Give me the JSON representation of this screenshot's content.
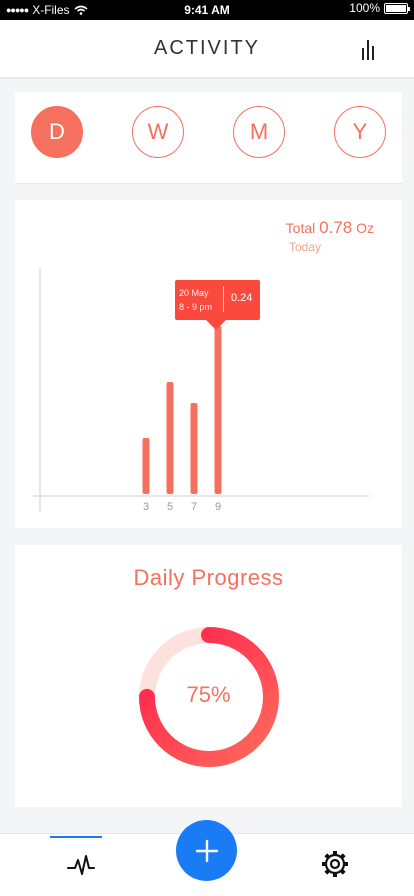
{
  "status_bar": {
    "carrier": "X-Files",
    "time": "9:41 AM",
    "battery": "100%"
  },
  "header": {
    "title": "ACTIVITY",
    "menu_icon": "equalizer-icon"
  },
  "periods": [
    {
      "label": "D",
      "active": true
    },
    {
      "label": "W",
      "active": false
    },
    {
      "label": "M",
      "active": false
    },
    {
      "label": "Y",
      "active": false
    }
  ],
  "summary": {
    "prefix": "Total",
    "amount": "0.78",
    "unit": "Oz",
    "subtitle": "Today"
  },
  "tooltip": {
    "date": "20 May",
    "time": "8 - 9 pm",
    "value": "0.24"
  },
  "chart_data": {
    "type": "bar",
    "categories": [
      "3",
      "5",
      "7",
      "9"
    ],
    "values": [
      0.08,
      0.16,
      0.13,
      0.24
    ],
    "ylim": [
      0,
      0.3
    ],
    "color": "#f5705e",
    "grid": false
  },
  "progress": {
    "title": "Daily Progress",
    "percent_label": "75%",
    "value": 0.75,
    "colors": {
      "track": "#fde1dc",
      "start": "#ff6b5c",
      "end": "#ff1e4b"
    }
  },
  "tabbar": {
    "left_icon": "activity-icon",
    "center_icon": "plus-icon",
    "right_icon": "gear-icon",
    "accent": "#1a7cf5"
  }
}
